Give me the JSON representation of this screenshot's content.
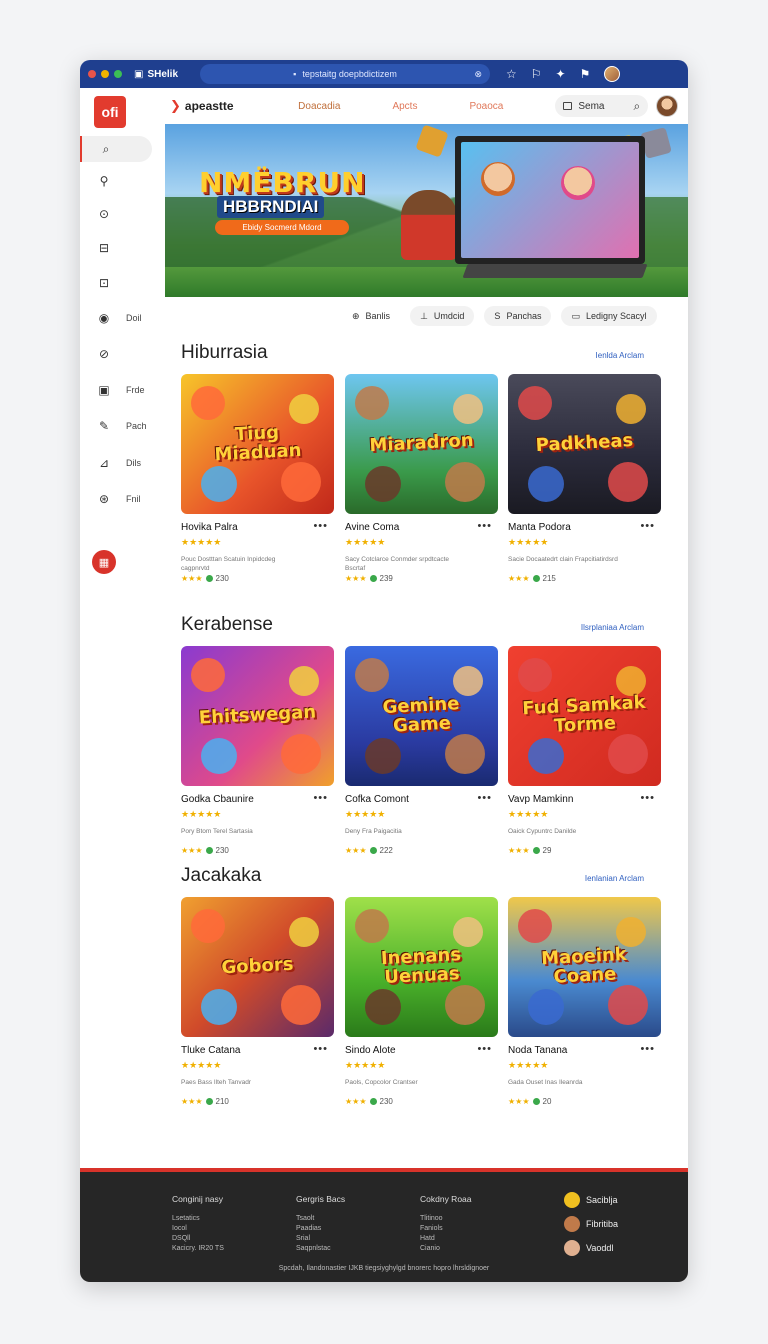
{
  "window": {
    "title": "SHelik",
    "url": "tepstaitg doepbdictizem",
    "traffic_colors": [
      "#e8544a",
      "#f0b400",
      "#3cbf55"
    ]
  },
  "topnav": {
    "brand": "apeastte",
    "links": [
      "Doacadia",
      "Apcts",
      "Poaoca"
    ],
    "search_label": "Sema"
  },
  "sidebar": {
    "logo": "ofi",
    "items": [
      {
        "icon": "search-icon",
        "glyph": "⌕",
        "label": ""
      },
      {
        "icon": "zoom-icon",
        "glyph": "⚲",
        "label": ""
      },
      {
        "icon": "circle-icon",
        "glyph": "⊙",
        "label": ""
      },
      {
        "icon": "briefcase-icon",
        "glyph": "⊟",
        "label": ""
      },
      {
        "icon": "lock-icon",
        "glyph": "⊡",
        "label": ""
      },
      {
        "icon": "target-icon",
        "glyph": "◉",
        "label": "Doil"
      },
      {
        "icon": "compass-icon",
        "glyph": "⊘",
        "label": ""
      },
      {
        "icon": "document-icon",
        "glyph": "▣",
        "label": "Frde"
      },
      {
        "icon": "pen-icon",
        "glyph": "✎",
        "label": "Pach"
      },
      {
        "icon": "chart-icon",
        "glyph": "⊿",
        "label": "Dils"
      },
      {
        "icon": "gamepad-icon",
        "glyph": "⊛",
        "label": "Fnil"
      }
    ],
    "red_button_glyph": "▦"
  },
  "hero": {
    "title": "NMËBRUN",
    "subtitle": "HBBRNDIAI",
    "cta": "Ebidy Socmerd Mdord"
  },
  "chips": [
    {
      "icon": "globe-icon",
      "glyph": "⊕",
      "label": "Banlis",
      "style": "plain"
    },
    {
      "icon": "person-icon",
      "glyph": "⊥",
      "label": "Umdcid",
      "style": "fill"
    },
    {
      "icon": "s-icon",
      "glyph": "S",
      "label": "Panchas",
      "style": "fill"
    },
    {
      "icon": "doc-icon",
      "glyph": "▭",
      "label": "Ledigny Scacyl",
      "style": "fill"
    }
  ],
  "sections": [
    {
      "title": "Hiburrasia",
      "link": "Ienlda Arclam",
      "cards": [
        {
          "title": "Hovika Palra",
          "stars": "★★★★★",
          "desc": "Pouc Dostttan Scatuin Inpidcdeg cagpnrvtd",
          "rating": "★★★",
          "count": "230",
          "art": "Tiug Miaduan",
          "bg": "linear-gradient(135deg,#f7c52a,#e8542a 60%,#c0281a)"
        },
        {
          "title": "Avine Coma",
          "stars": "★★★★★",
          "desc": "Sacy Cotclarce Conmder srpdtcacte Bscrtaf",
          "rating": "★★★",
          "count": "239",
          "art": "Miaradron",
          "bg": "linear-gradient(180deg,#6ec6f0,#3a9a4a 70%,#2a6a2a)"
        },
        {
          "title": "Manta Podora",
          "stars": "★★★★★",
          "desc": "Sacie Docaatedrt clain Frapcitiatirdsrd",
          "rating": "★★★",
          "count": "215",
          "art": "Padkheas",
          "bg": "linear-gradient(180deg,#4a4a5a,#2a2a3a 60%,#1a1a22)"
        }
      ]
    },
    {
      "title": "Kerabense",
      "link": "Ilsrplaniaa Arclam",
      "cards": [
        {
          "title": "Godka Cbaunire",
          "stars": "★★★★★",
          "desc": "Pory Btom Terel Sartasia",
          "rating": "★★★",
          "count": "230",
          "art": "Ehitswegan",
          "bg": "linear-gradient(135deg,#8a3ad0,#e04a8a 60%,#f0a02a)"
        },
        {
          "title": "Cofka Comont",
          "stars": "★★★★★",
          "desc": "Deny Fra Paigacitia",
          "rating": "★★★",
          "count": "222",
          "art": "Gemine Game",
          "bg": "linear-gradient(180deg,#3a6ae0,#2a3aa0 70%,#1a2a70)"
        },
        {
          "title": "Vavp Mamkinn",
          "stars": "★★★★★",
          "desc": "Oaick Cypuntrc Danilde",
          "rating": "★★★",
          "count": "29",
          "art": "Fud Samkak Torme",
          "bg": "linear-gradient(135deg,#f04030,#d02a20)"
        }
      ]
    },
    {
      "title": "Jacakaka",
      "link": "Ienlanian Arclam",
      "cards": [
        {
          "title": "Tluke Catana",
          "stars": "★★★★★",
          "desc": "Paes Bass Ilteh Tanvadr",
          "rating": "★★★",
          "count": "210",
          "art": "Gobors",
          "bg": "linear-gradient(135deg,#f0a030,#d04a2a 50%,#5a2a6a)"
        },
        {
          "title": "Sindo Alote",
          "stars": "★★★★★",
          "desc": "Paols, Copcolor Crantser",
          "rating": "★★★",
          "count": "230",
          "art": "Inenans Uenuas",
          "bg": "linear-gradient(180deg,#a0e04a,#4ab02a 60%,#2a7a1a)"
        },
        {
          "title": "Noda Tanana",
          "stars": "★★★★★",
          "desc": "Gada Ouset Inas Ileanrda",
          "rating": "★★★",
          "count": "20",
          "art": "Maoeink Coane",
          "bg": "linear-gradient(180deg,#f0c84a,#4a8ad0 60%,#2a4a8a)"
        }
      ]
    }
  ],
  "footer": {
    "columns": [
      {
        "heading": "Conginij nasy",
        "links": [
          "Lsetatics",
          "Iocol",
          "DSQll",
          "Kacicry. IR20 TS"
        ]
      },
      {
        "heading": "Gergris Bacs",
        "links": [
          "Tsaolt",
          "Paadias",
          "Srial",
          "Saqpnlstac"
        ]
      },
      {
        "heading": "Cokdny Roaa",
        "links": [
          "Tlitinoo",
          "Faniols",
          "Hatd",
          "Cianio"
        ]
      }
    ],
    "social": [
      {
        "icon": "game-controller-icon",
        "label": "Saciblja",
        "color": "#f0c020"
      },
      {
        "icon": "avatar-icon",
        "label": "Fibritiba",
        "color": "#c07a4a"
      },
      {
        "icon": "avatar-icon",
        "label": "Vaoddl",
        "color": "#e0b090"
      }
    ],
    "copyright": "Spcdah, Ilandonastier IJKB tiegsiyghylgd bnorerc hopro lhrsldignoer"
  }
}
